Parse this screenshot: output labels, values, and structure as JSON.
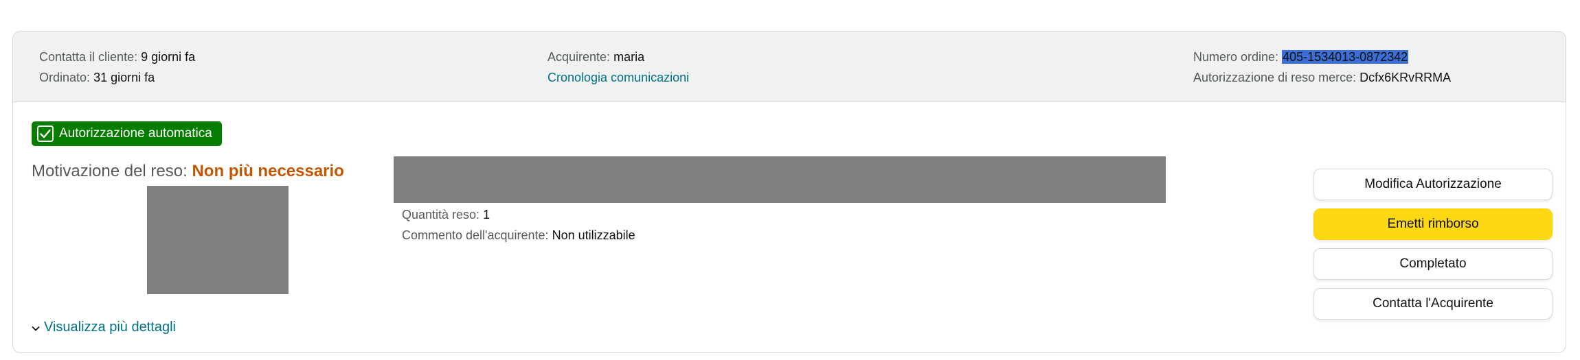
{
  "header": {
    "contact_label": "Contatta il cliente:",
    "contact_value": "9 giorni fa",
    "ordered_label": "Ordinato:",
    "ordered_value": "31 giorni fa",
    "buyer_label": "Acquirente:",
    "buyer_value": "maria",
    "comm_history_link": "Cronologia comunicazioni",
    "order_number_label": "Numero ordine:",
    "order_number_value": "405-1534013-0872342",
    "rma_label": "Autorizzazione di reso merce:",
    "rma_value": "Dcfx6KRvRRMA"
  },
  "badge": {
    "label": "Autorizzazione automatica",
    "icon": "checkmark-icon",
    "color": "#067d00"
  },
  "reason": {
    "label": "Motivazione del reso:",
    "value": "Non più necessario",
    "value_color": "#c45500"
  },
  "item": {
    "qty_label": "Quantità reso:",
    "qty_value": "1",
    "comment_label": "Commento dell'acquirente:",
    "comment_value": "Non utilizzabile"
  },
  "actions": {
    "modify": "Modifica Autorizzazione",
    "refund": "Emetti rimborso",
    "completed": "Completato",
    "contact": "Contatta l'Acquirente",
    "primary_color": "#ffd814"
  },
  "details_link": {
    "label": "Visualizza più dettagli",
    "icon": "chevron-down-icon"
  }
}
